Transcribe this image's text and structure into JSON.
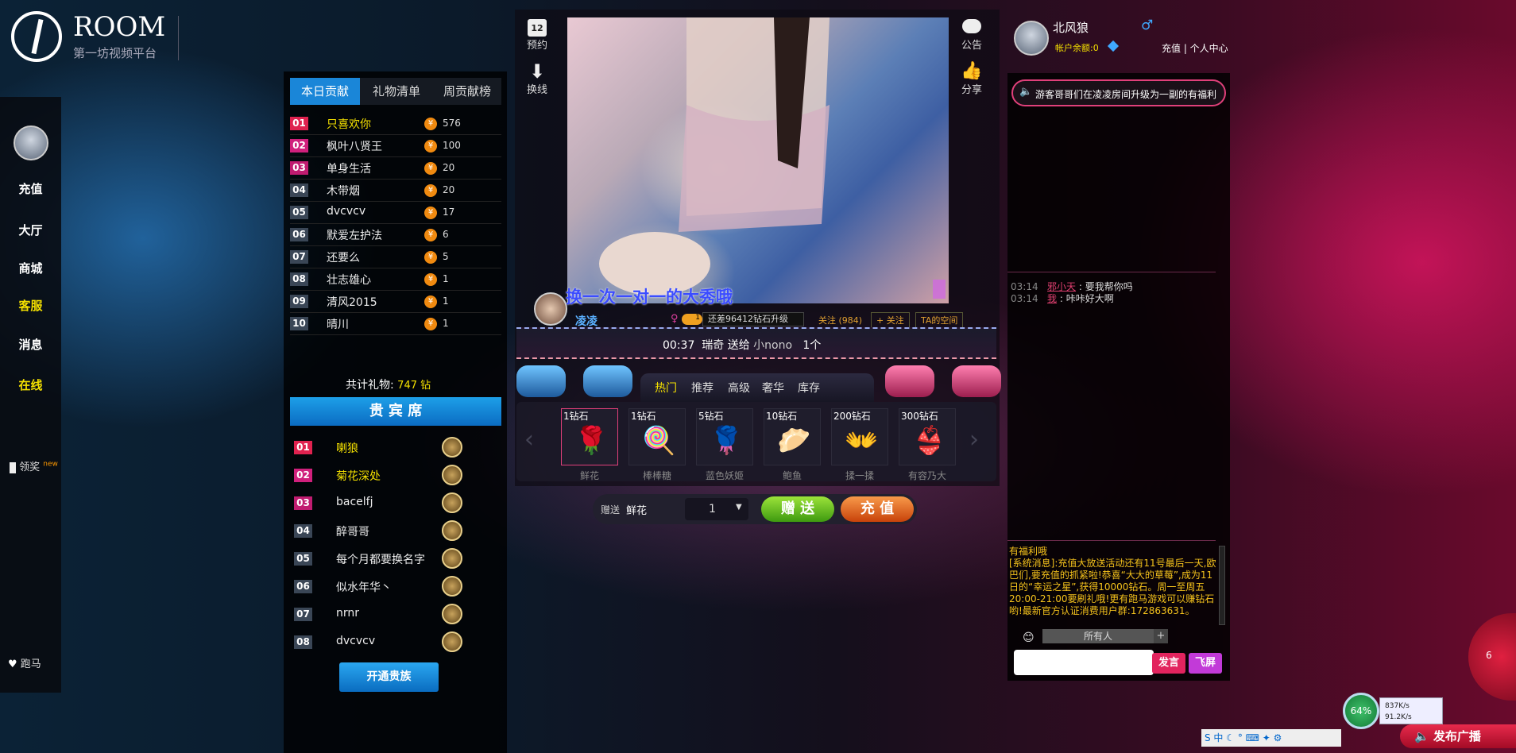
{
  "logo": {
    "brand": "ROOM",
    "tagline": "第一坊视频平台"
  },
  "nav": {
    "items": [
      "充值",
      "大厅",
      "商城",
      "客服",
      "消息",
      "在线"
    ],
    "lottery": "领奖",
    "lottery_badge": "new",
    "horse": "跑马"
  },
  "rank": {
    "tabs": [
      "本日贡献",
      "礼物清单",
      "周贡献榜"
    ],
    "rows": [
      {
        "n": "01",
        "name": "只喜欢你",
        "val": "576"
      },
      {
        "n": "02",
        "name": "枫叶八贤王",
        "val": "100"
      },
      {
        "n": "03",
        "name": "单身生活",
        "val": "20"
      },
      {
        "n": "04",
        "name": "木带烟",
        "val": "20"
      },
      {
        "n": "05",
        "name": "dvcvcv",
        "val": "17"
      },
      {
        "n": "06",
        "name": "默爱左护法",
        "val": "6"
      },
      {
        "n": "07",
        "name": "还要么",
        "val": "5"
      },
      {
        "n": "08",
        "name": "壮志雄心",
        "val": "1"
      },
      {
        "n": "09",
        "name": "清风2015",
        "val": "1"
      },
      {
        "n": "10",
        "name": "晴川",
        "val": "1"
      }
    ],
    "total_label": "共计礼物:",
    "total_value": "747 钻",
    "coin_glyph": "¥"
  },
  "vip": {
    "title": "贵 宾 席",
    "rows": [
      {
        "n": "01",
        "name": "喇狼"
      },
      {
        "n": "02",
        "name": "菊花深处"
      },
      {
        "n": "03",
        "name": "bacelfj"
      },
      {
        "n": "04",
        "name": "醉哥哥"
      },
      {
        "n": "05",
        "name": "每个月都要换名字"
      },
      {
        "n": "06",
        "name": "似水年华丶"
      },
      {
        "n": "07",
        "name": "nrnr"
      },
      {
        "n": "08",
        "name": "dvcvcv"
      }
    ],
    "open_button": "开通贵族"
  },
  "stage": {
    "left_buttons": [
      {
        "icon": "calendar-icon",
        "num": "12",
        "label": "预约"
      },
      {
        "icon": "arrow-down-icon",
        "label": "换线"
      }
    ],
    "right_buttons": [
      {
        "icon": "speech-bubble-icon",
        "label": "公告"
      },
      {
        "icon": "thumbs-up-icon",
        "label": "分享"
      }
    ],
    "subtitle": "换一次一对一的大秀哦",
    "host": {
      "name": "凌凌",
      "level": "1",
      "upgrade": "还差96412钻石升级",
      "follow_count": "关注 (984)",
      "follow_btn": "+ 关注",
      "space": "TA的空间"
    },
    "marquee": {
      "time": "00:37",
      "from": "瑞奇",
      "action": "送给",
      "to": "小nono",
      "count": "1个"
    }
  },
  "gifts": {
    "tabs": [
      "热门",
      "推荐",
      "高级",
      "奢华",
      "库存"
    ],
    "items": [
      {
        "price": "1钻石",
        "name": "鲜花"
      },
      {
        "price": "1钻石",
        "name": "棒棒糖"
      },
      {
        "price": "5钻石",
        "name": "蓝色妖姬"
      },
      {
        "price": "10钻石",
        "name": "鲍鱼"
      },
      {
        "price": "200钻石",
        "name": "揉一揉"
      },
      {
        "price": "300钻石",
        "name": "有容乃大"
      }
    ],
    "send_label": "赠送",
    "selected": "鲜花",
    "qty": "1",
    "give_btn": "赠 送",
    "recharge_btn": "充 值"
  },
  "user": {
    "name": "北风狼",
    "balance_label": "帐户余额:0",
    "links": "充值 | 个人中心",
    "gender": "♂"
  },
  "chat": {
    "marquee": "游客哥哥们在凌凌房间升级为一副的有福利",
    "lines": [
      {
        "time": "03:14",
        "user": "邪小天",
        "text": "要我帮你吗"
      },
      {
        "time": "03:14",
        "user": "我",
        "text": "咔咔好大啊"
      }
    ],
    "system": "有福利哦\n[系统消息]:充值大放送活动还有11号最后一天,欧巴们,要充值的抓紧啦!恭喜“大大的草莓”,成为11日的“幸运之星”,获得10000钻石。周一至周五20:00-21:00要刷礼哦!更有跑马游戏可以赚钻石哟!最新官方认证消费用户群:172863631。",
    "target": "所有人",
    "speak_btn": "发言",
    "fly_btn": "飞屏"
  },
  "system_tray": {
    "cpu": "64%",
    "up": "837K/s",
    "down": "91.2K/s",
    "broadcast": "发布广播",
    "side_count": "6"
  }
}
